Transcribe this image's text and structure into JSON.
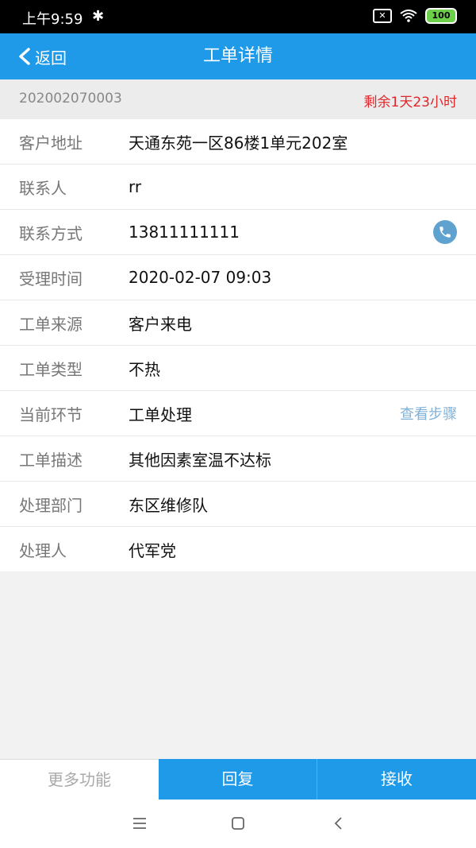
{
  "status_bar": {
    "time": "上午9:59",
    "battery": "100"
  },
  "nav": {
    "back_label": "返回",
    "title": "工单详情"
  },
  "order": {
    "id": "202002070003",
    "remaining": "剩余1天23小时"
  },
  "fields": [
    {
      "label": "客户地址",
      "value": "天通东苑一区86楼1单元202室"
    },
    {
      "label": "联系人",
      "value": "rr"
    },
    {
      "label": "联系方式",
      "value": "13811111111"
    },
    {
      "label": "受理时间",
      "value": "2020-02-07 09:03"
    },
    {
      "label": "工单来源",
      "value": "客户来电"
    },
    {
      "label": "工单类型",
      "value": "不热"
    },
    {
      "label": "当前环节",
      "value": "工单处理"
    },
    {
      "label": "工单描述",
      "value": "其他因素室温不达标"
    },
    {
      "label": "处理部门",
      "value": "东区维修队"
    },
    {
      "label": "处理人",
      "value": "代军党"
    }
  ],
  "step_link": "查看步骤",
  "bottom": {
    "more": "更多功能",
    "reply": "回复",
    "receive": "接收"
  },
  "colors": {
    "accent": "#1e9ae8",
    "alert": "#e0262b",
    "link": "#7fb2d9"
  }
}
